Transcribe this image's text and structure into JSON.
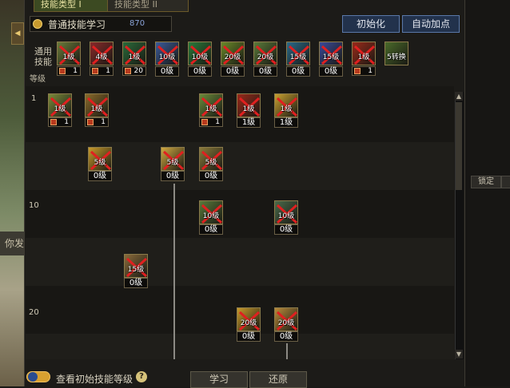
{
  "tabs": [
    "技能类型 I",
    "技能类型 II"
  ],
  "skill_type": {
    "label": "普通技能学习",
    "sp": "870"
  },
  "buttons": {
    "reset": "初始化",
    "auto": "自动加点",
    "learn": "学习",
    "restore": "还原",
    "lock": "锁定"
  },
  "common_label": "通用\n技能",
  "level_label": "等级",
  "background_chat": "你发出消息",
  "show_initial": "查看初始技能等级",
  "help": "?",
  "side_arrow": "◀",
  "scroll": {
    "up": "▲",
    "down": "▼"
  },
  "colors": {
    "icon_red": "#b02418",
    "icon_green": "#3a8a3a",
    "icon_blue": "#2a5a9a",
    "icon_yellow": "#c8a030",
    "cross": "#e02020"
  },
  "common_skills": [
    {
      "level": "1级",
      "badge": "1",
      "color": "#6a7a3a"
    },
    {
      "level": "4级",
      "badge": "1",
      "color": "#8a2a2a"
    },
    {
      "level": "1级",
      "badge": "20",
      "color": "#2a6a3a"
    },
    {
      "level": "10级",
      "badge": "0级",
      "color": "#3a5a9a"
    },
    {
      "level": "10级",
      "badge": "0级",
      "color": "#2a7a3a"
    },
    {
      "level": "20级",
      "badge": "0级",
      "color": "#6a8a2a"
    },
    {
      "level": "20级",
      "badge": "0级",
      "color": "#5a7a3a"
    },
    {
      "level": "15级",
      "badge": "0级",
      "color": "#2a6a8a"
    },
    {
      "level": "15级",
      "badge": "0级",
      "color": "#3a4a9a"
    },
    {
      "level": "1级",
      "badge": "1",
      "color": "#9a2a1a"
    },
    {
      "level": "5转换",
      "badge": "",
      "color": "#4a6a2a"
    }
  ],
  "tree_levels": [
    "1",
    "10",
    "20"
  ],
  "tree_skills": [
    {
      "level": "1级",
      "badge": "1",
      "type": "m",
      "color": "#7a8a3a"
    },
    {
      "level": "1级",
      "badge": "1",
      "type": "m",
      "color": "#8a6a2a"
    },
    {
      "level": "1级",
      "badge": "1",
      "type": "m",
      "color": "#6a8a3a"
    },
    {
      "level": "1级",
      "badge": "1级",
      "type": "lv",
      "color": "#9a2a1a"
    },
    {
      "level": "1级",
      "badge": "1级",
      "type": "lv",
      "color": "#c8a030"
    },
    {
      "level": "5级",
      "badge": "0级",
      "type": "lv",
      "color": "#c89a2a"
    },
    {
      "level": "5级",
      "badge": "0级",
      "type": "lv",
      "color": "#d0a840"
    },
    {
      "level": "5级",
      "badge": "0级",
      "type": "lv",
      "color": "#8a7a3a"
    },
    {
      "level": "10级",
      "badge": "0级",
      "type": "lv",
      "color": "#5a7a3a"
    },
    {
      "level": "10级",
      "badge": "0级",
      "type": "lv",
      "color": "#4a6a4a"
    },
    {
      "level": "15级",
      "badge": "0级",
      "type": "lv",
      "color": "#8a6a3a"
    },
    {
      "level": "20级",
      "badge": "0级",
      "type": "lv",
      "color": "#c89a2a"
    },
    {
      "level": "20级",
      "badge": "0级",
      "type": "lv",
      "color": "#b88a3a"
    }
  ]
}
